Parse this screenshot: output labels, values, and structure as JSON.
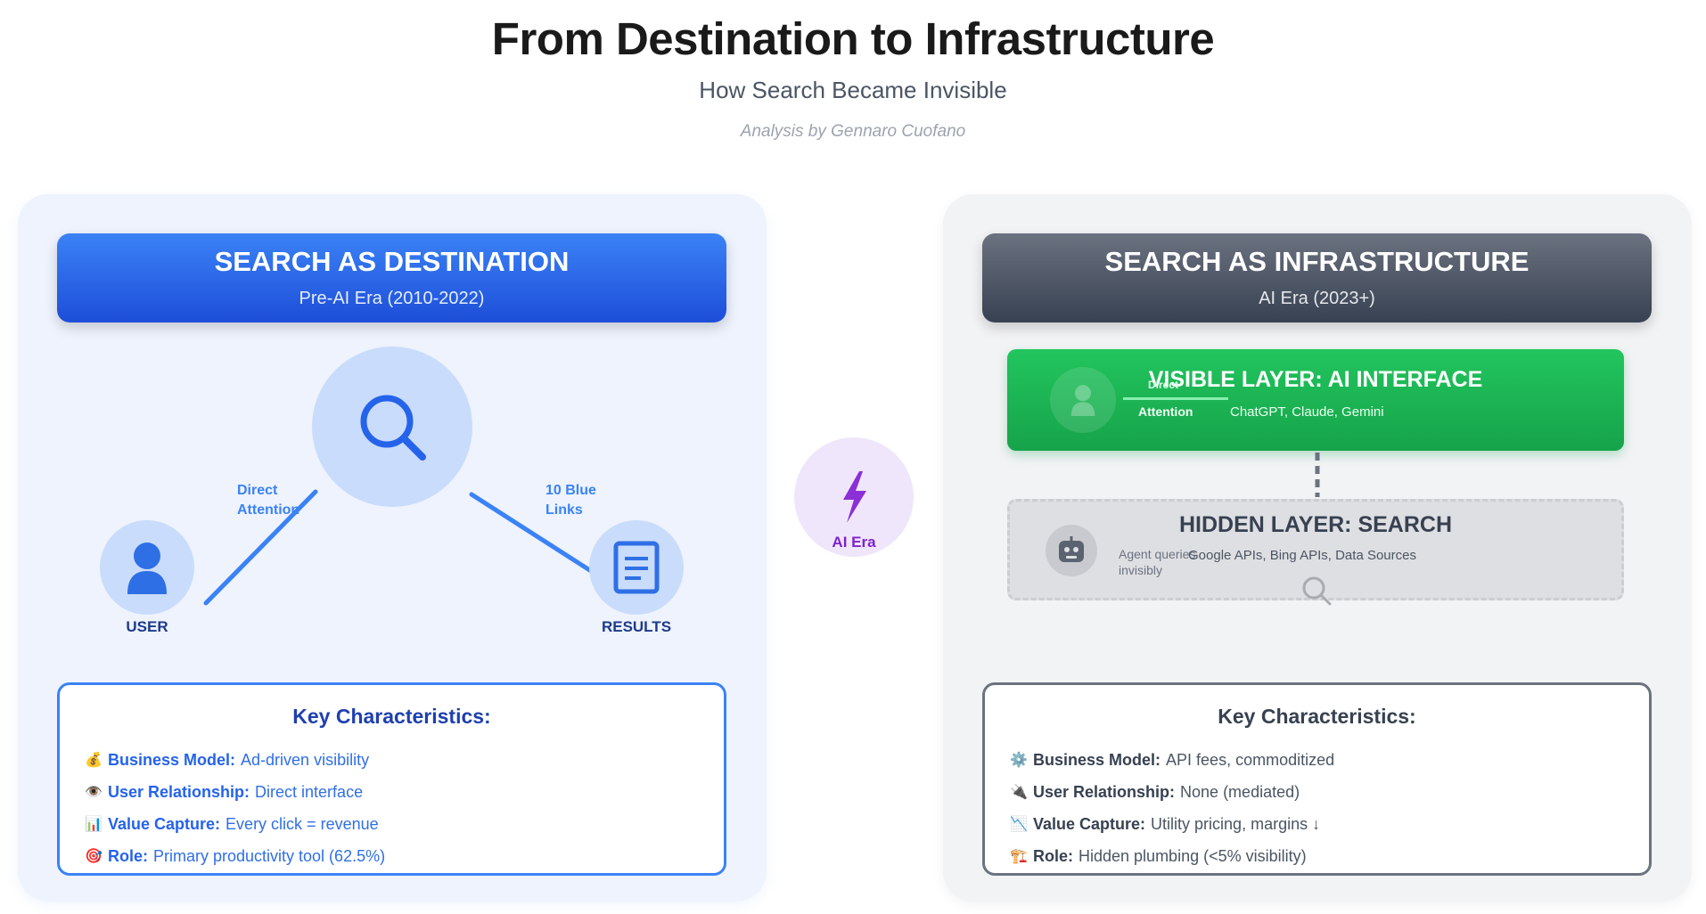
{
  "header": {
    "title": "From Destination to Infrastructure",
    "subtitle": "How Search Became Invisible",
    "author": "Analysis by Gennaro Cuofano"
  },
  "left": {
    "banner_title": "SEARCH AS DESTINATION",
    "banner_sub": "Pre-AI Era (2010-2022)",
    "nodes": {
      "user": "USER",
      "results": "RESULTS"
    },
    "edges": {
      "user_search_line1": "Direct",
      "user_search_line2": "Attention",
      "search_results_line1": "10 Blue",
      "search_results_line2": "Links"
    },
    "characteristics": {
      "title": "Key Characteristics:",
      "items": [
        {
          "icon": "💰",
          "icon_name": "money-bag-icon",
          "label": "Business Model:",
          "value": "Ad-driven visibility"
        },
        {
          "icon": "👁️",
          "icon_name": "eye-icon",
          "label": "User Relationship:",
          "value": "Direct interface"
        },
        {
          "icon": "📊",
          "icon_name": "bar-chart-icon",
          "label": "Value Capture:",
          "value": "Every click = revenue"
        },
        {
          "icon": "🎯",
          "icon_name": "target-icon",
          "label": "Role:",
          "value": "Primary productivity tool (62.5%)"
        }
      ]
    }
  },
  "center": {
    "label": "AI Era"
  },
  "right": {
    "banner_title": "SEARCH AS INFRASTRUCTURE",
    "banner_sub": "AI Era (2023+)",
    "visible_layer": {
      "title": "VISIBLE LAYER: AI INTERFACE",
      "sub": "ChatGPT, Claude, Gemini",
      "attention_a": "Direct",
      "attention_b": "Attention"
    },
    "hidden_layer": {
      "title": "HIDDEN LAYER: SEARCH",
      "sub": "Google APIs, Bing APIs, Data Sources",
      "agent_line1": "Agent queries",
      "agent_line2": "invisibly"
    },
    "characteristics": {
      "title": "Key Characteristics:",
      "items": [
        {
          "icon": "⚙️",
          "icon_name": "gear-icon",
          "label": "Business Model:",
          "value": "API fees, commoditized"
        },
        {
          "icon": "🔌",
          "icon_name": "plug-icon",
          "label": "User Relationship:",
          "value": "None (mediated)"
        },
        {
          "icon": "📉",
          "icon_name": "chart-down-icon",
          "label": "Value Capture:",
          "value": "Utility pricing, margins ↓"
        },
        {
          "icon": "🏗️",
          "icon_name": "construction-icon",
          "label": "Role:",
          "value": "Hidden plumbing (<5% visibility)"
        }
      ]
    }
  },
  "colors": {
    "blue_accent": "#3b82f6",
    "blue_dark": "#1d4ed8",
    "gray_dark": "#374151",
    "green": "#22c55e",
    "purple": "#7e22ce"
  }
}
